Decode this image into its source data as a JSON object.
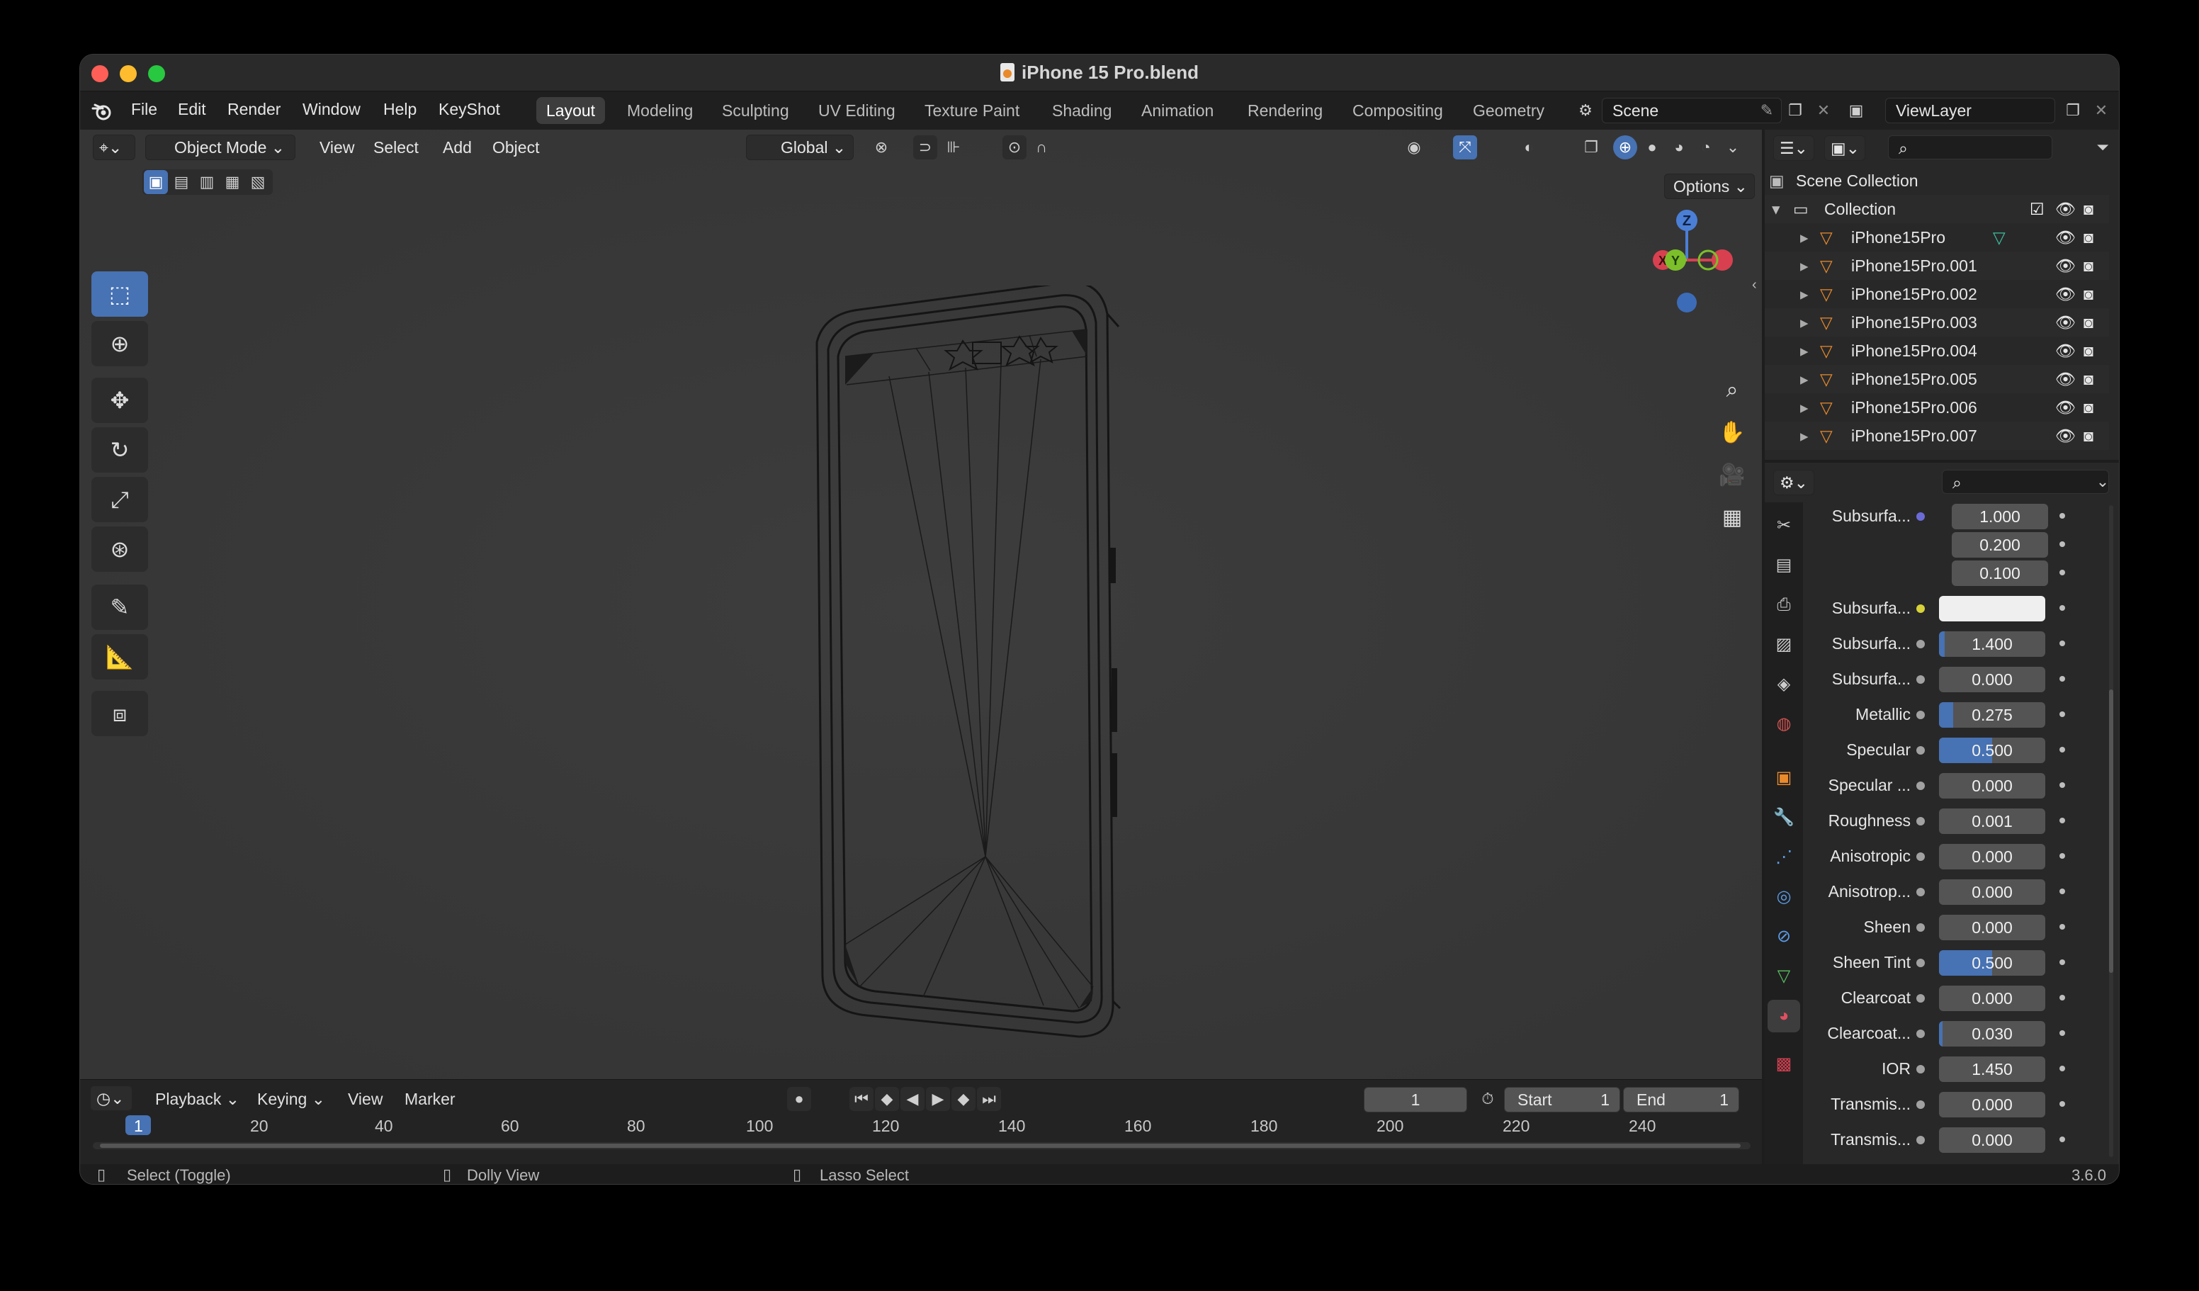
{
  "window": {
    "title": "iPhone 15 Pro.blend"
  },
  "menus": [
    "File",
    "Edit",
    "Render",
    "Window",
    "Help",
    "KeyShot"
  ],
  "workspace_tabs": [
    "Layout",
    "Modeling",
    "Sculpting",
    "UV Editing",
    "Texture Paint",
    "Shading",
    "Animation",
    "Rendering",
    "Compositing",
    "Geometry"
  ],
  "active_workspace": "Layout",
  "scene": {
    "name": "Scene",
    "view_layer": "ViewLayer"
  },
  "viewport": {
    "mode": "Object Mode",
    "menus": [
      "View",
      "Select",
      "Add",
      "Object"
    ],
    "transform_orientation": "Global",
    "options_label": "Options",
    "gizmo": {
      "z": "Z",
      "x": "X",
      "y": "Y"
    }
  },
  "tools": [
    "select-box",
    "cursor",
    "move",
    "rotate",
    "scale",
    "transform",
    "annotate",
    "measure",
    "add-cube"
  ],
  "outliner": {
    "root": "Scene Collection",
    "collection": "Collection",
    "objects": [
      "iPhone15Pro",
      "iPhone15Pro.001",
      "iPhone15Pro.002",
      "iPhone15Pro.003",
      "iPhone15Pro.004",
      "iPhone15Pro.005",
      "iPhone15Pro.006",
      "iPhone15Pro.007"
    ]
  },
  "properties": {
    "subsurface_radius": {
      "label": "Subsurfa...",
      "values": [
        "1.000",
        "0.200",
        "0.100"
      ]
    },
    "rows": [
      {
        "label": "Subsurfa...",
        "value": "",
        "kind": "color",
        "socket": "#d8d23a"
      },
      {
        "label": "Subsurfa...",
        "value": "1.400",
        "fill": 0.05
      },
      {
        "label": "Subsurfa...",
        "value": "0.000",
        "fill": 0
      },
      {
        "label": "Metallic",
        "value": "0.275",
        "fill": 0.13
      },
      {
        "label": "Specular",
        "value": "0.500",
        "fill": 0.5
      },
      {
        "label": "Specular ...",
        "value": "0.000",
        "fill": 0
      },
      {
        "label": "Roughness",
        "value": "0.001",
        "fill": 0
      },
      {
        "label": "Anisotropic",
        "value": "0.000",
        "fill": 0
      },
      {
        "label": "Anisotrop...",
        "value": "0.000",
        "fill": 0
      },
      {
        "label": "Sheen",
        "value": "0.000",
        "fill": 0
      },
      {
        "label": "Sheen Tint",
        "value": "0.500",
        "fill": 0.5
      },
      {
        "label": "Clearcoat",
        "value": "0.000",
        "fill": 0
      },
      {
        "label": "Clearcoat...",
        "value": "0.030",
        "fill": 0.03
      },
      {
        "label": "IOR",
        "value": "1.450",
        "fill": 0
      },
      {
        "label": "Transmis...",
        "value": "0.000",
        "fill": 0
      },
      {
        "label": "Transmis...",
        "value": "0.000",
        "fill": 0
      }
    ]
  },
  "timeline": {
    "menus": [
      "Playback",
      "Keying",
      "View",
      "Marker"
    ],
    "current_frame": "1",
    "start_label": "Start",
    "start": "1",
    "end_label": "End",
    "end": "1",
    "ticks": [
      "1",
      "20",
      "40",
      "60",
      "80",
      "100",
      "120",
      "140",
      "160",
      "180",
      "200",
      "220",
      "240"
    ]
  },
  "status": {
    "left": "Select (Toggle)",
    "middle": "Dolly View",
    "right": "Lasso Select",
    "version": "3.6.0"
  },
  "colors": {
    "accent": "#4772b3",
    "object_icon": "#e98a2c"
  }
}
